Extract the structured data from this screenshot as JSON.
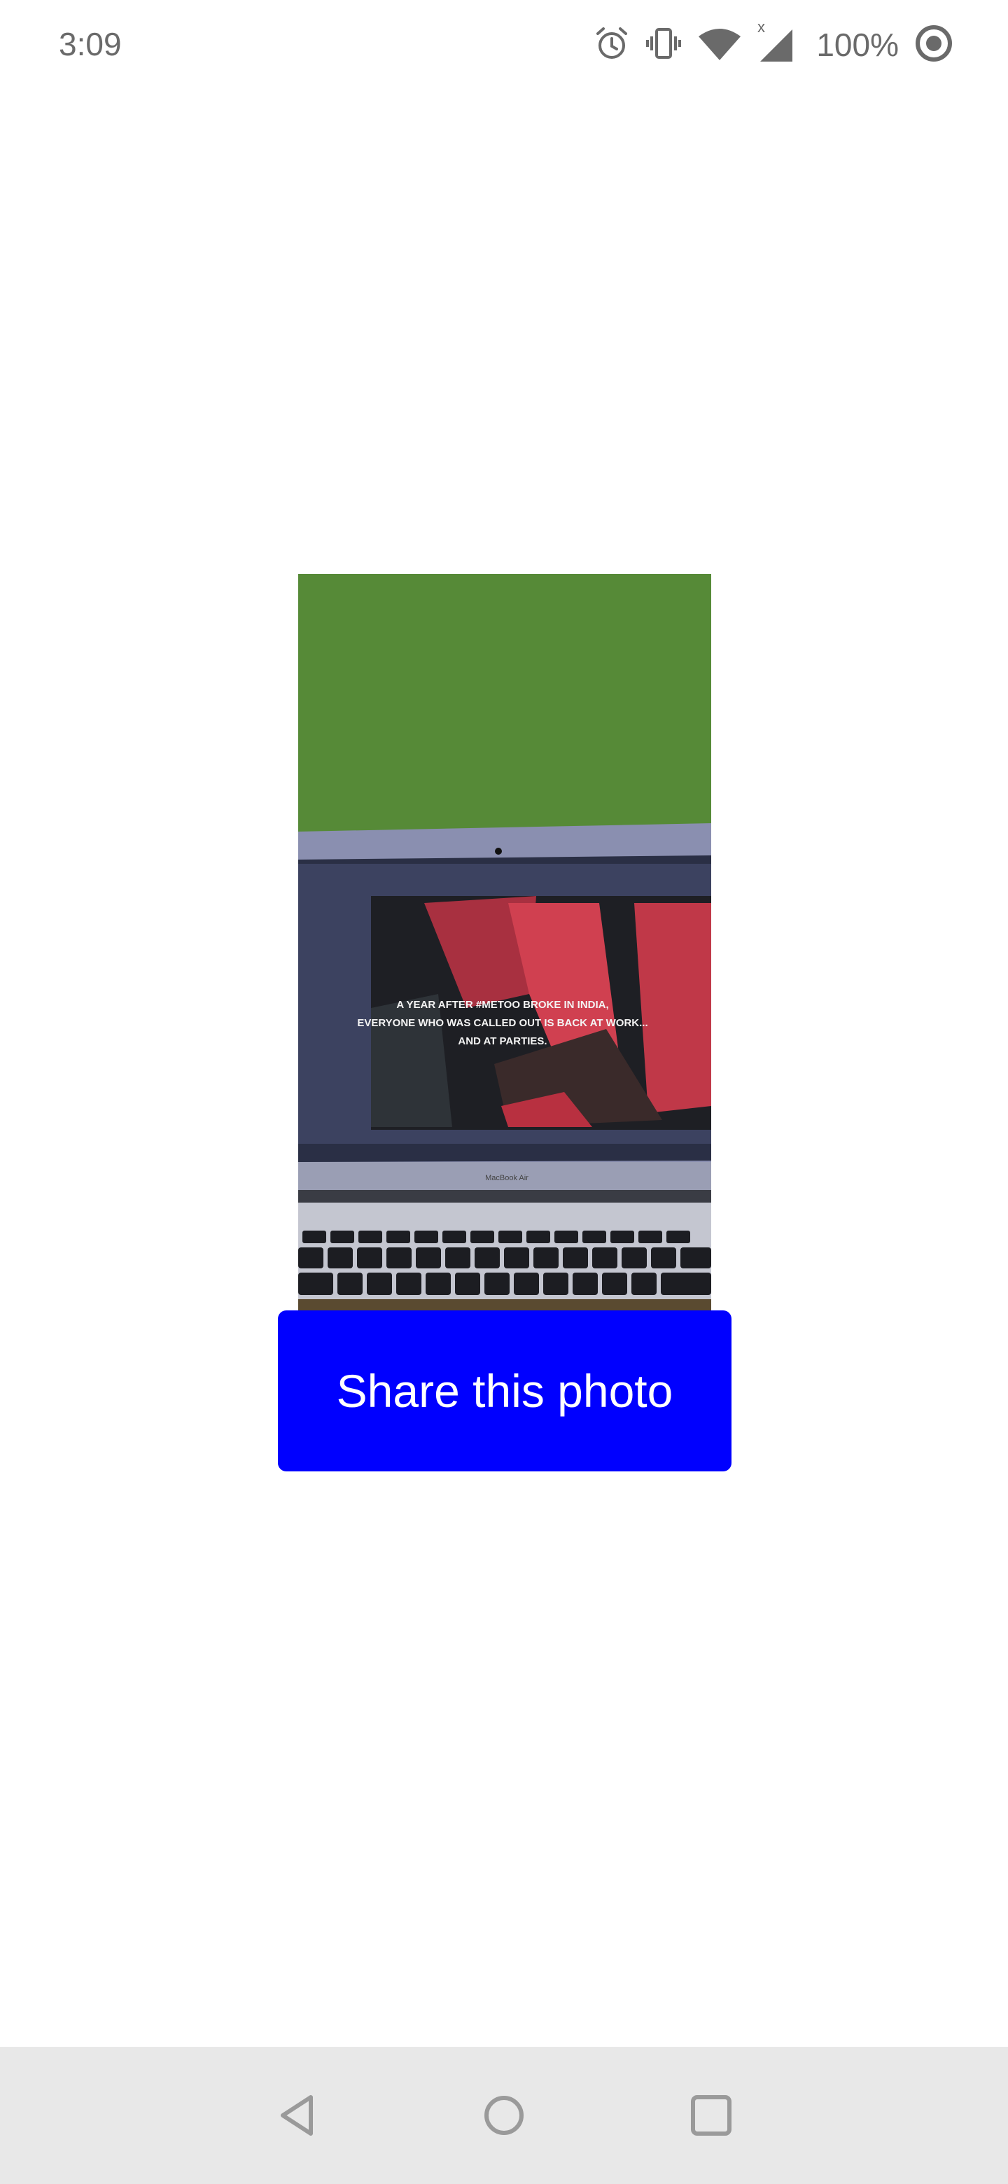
{
  "status_bar": {
    "time": "3:09",
    "battery_percent": "100%",
    "icons": [
      "alarm-icon",
      "vibrate-icon",
      "wifi-icon",
      "cellular-signal-icon",
      "battery-icon"
    ],
    "color": "#6a6a6a"
  },
  "photo": {
    "description_icon": "photo-image",
    "screen_text_line1": "A YEAR AFTER #METOO BROKE IN INDIA,",
    "screen_text_line2": "EVERYONE WHO WAS CALLED OUT IS BACK AT WORK...",
    "screen_text_line3": "AND AT PARTIES.",
    "laptop_brand": "MacBook Air"
  },
  "share_button": {
    "label": "Share this photo",
    "background": "#0000ff",
    "text_color": "#ffffff"
  },
  "nav_bar": {
    "background": "#e8e8e8",
    "buttons": [
      "back-icon",
      "home-icon",
      "recents-icon"
    ]
  }
}
